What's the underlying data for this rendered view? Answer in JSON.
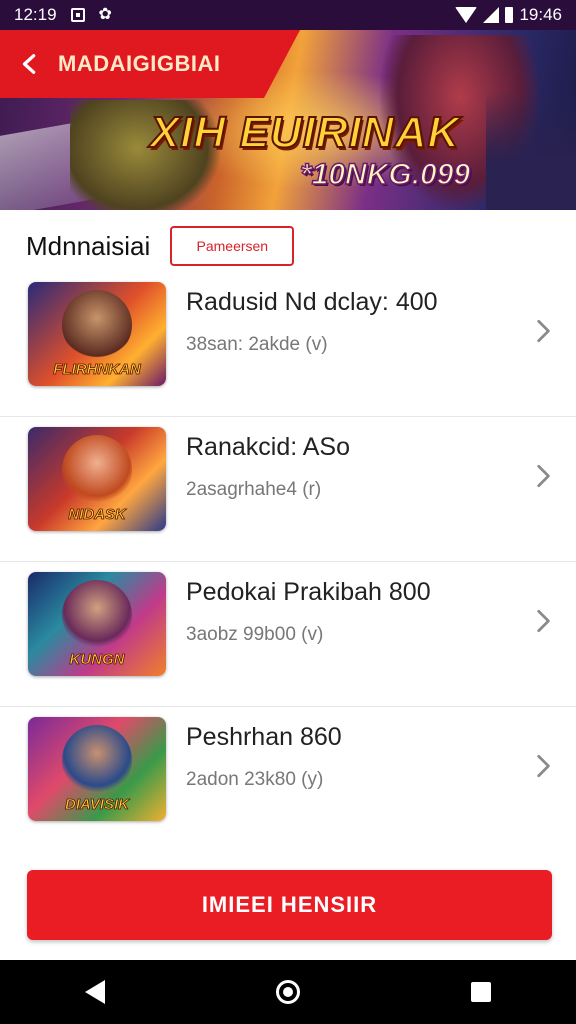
{
  "status_bar": {
    "time": "12:19",
    "clock": "19:46",
    "icons": [
      "notification-icon",
      "settings-icon",
      "wifi-icon",
      "signal-icon",
      "battery-icon"
    ]
  },
  "banner": {
    "header_title": "MADAIGIGBIAI",
    "title": "XIH EUIRINAK",
    "subtitle": "*10NKG.099",
    "back_icon": "back-arrow-icon"
  },
  "section": {
    "title": "Mdnnaisiai",
    "filter_label": "Pameersen"
  },
  "items": [
    {
      "title": "Radusid Nd dclay: 400",
      "subtitle": "38san: 2akde  (v)",
      "thumb_label": "FLIRHNKAN"
    },
    {
      "title": "Ranakcid: ASo",
      "subtitle": "2asagrhahe4  (r)",
      "thumb_label": "NIDASK"
    },
    {
      "title": "Pedokai Prakibah 800",
      "subtitle": "3aobz 99b00  (v)",
      "thumb_label": "KUNGN"
    },
    {
      "title": "Peshrhan 860",
      "subtitle": "2adon 23k80  (y)",
      "thumb_label": "DIAVISIK"
    }
  ],
  "cta": {
    "label": "IMIEEI HENSIIR"
  },
  "nav": {
    "back": "back-icon",
    "home": "home-icon",
    "recent": "recent-apps-icon"
  },
  "colors": {
    "accent": "#e0181f",
    "status_bar": "#2a0d3a",
    "title_gold": "#ffd23a"
  }
}
